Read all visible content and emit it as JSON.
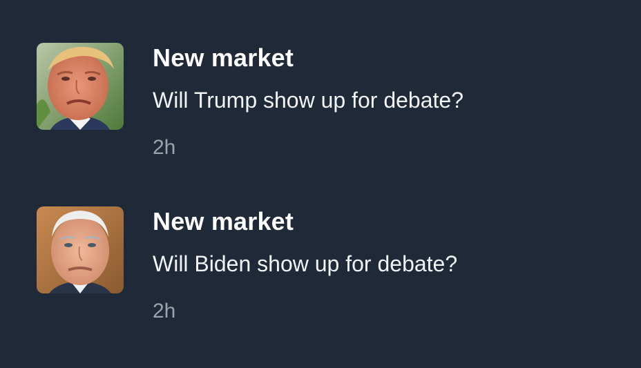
{
  "notifications": [
    {
      "title": "New market",
      "question": "Will Trump show up for debate?",
      "time": "2h",
      "avatar": "trump-portrait"
    },
    {
      "title": "New market",
      "question": "Will Biden show up for debate?",
      "time": "2h",
      "avatar": "biden-portrait"
    }
  ],
  "colors": {
    "background": "#1f2937",
    "title": "#ffffff",
    "question": "#f3f4f6",
    "time": "#9ca3af"
  }
}
